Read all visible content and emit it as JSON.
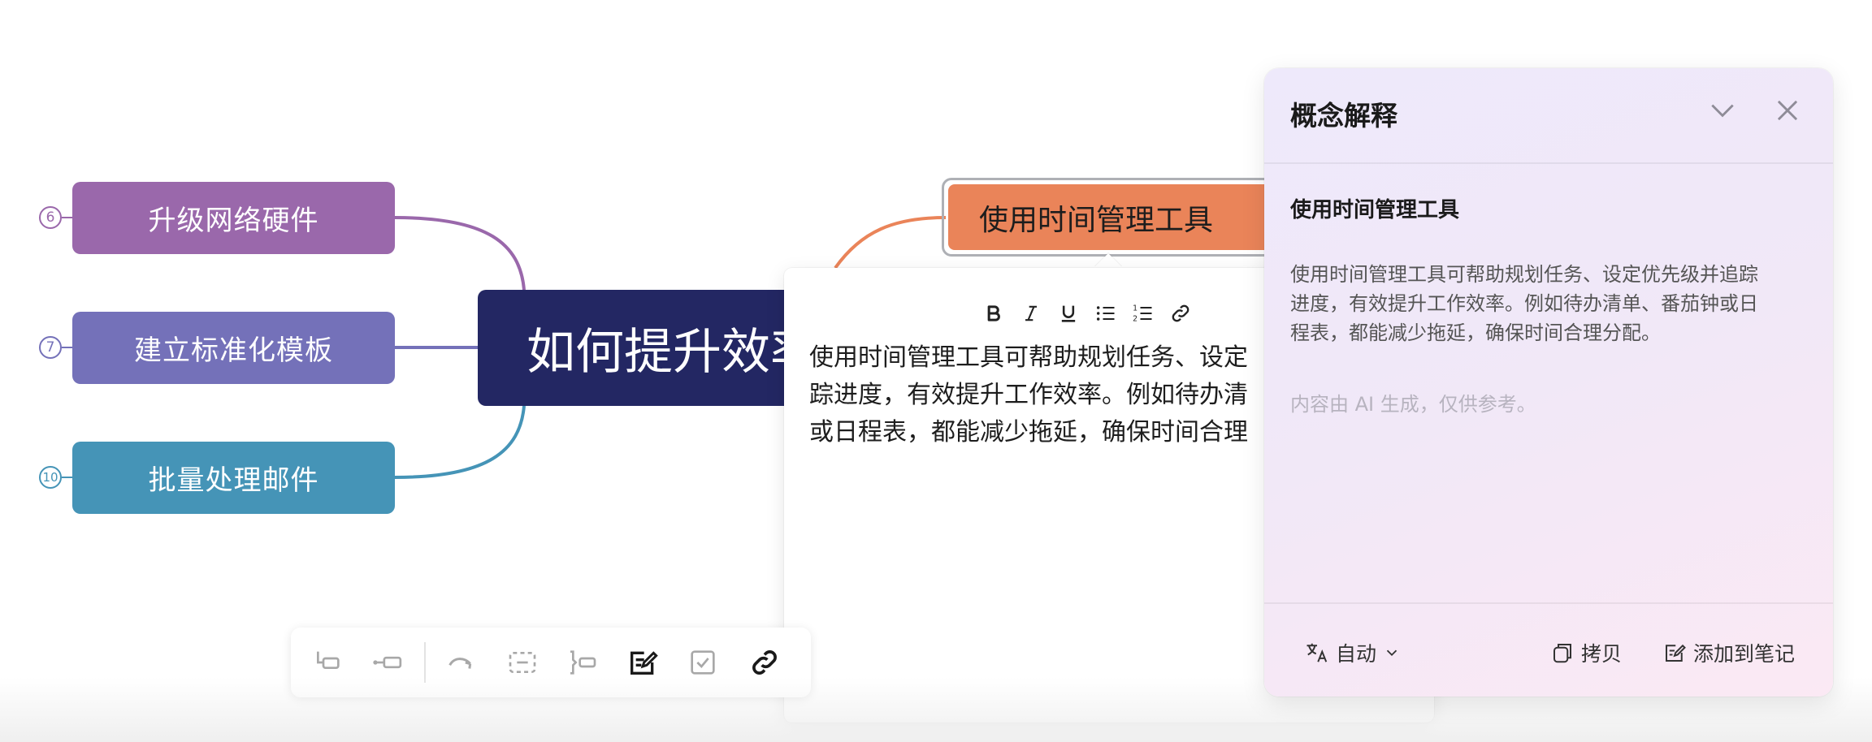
{
  "mindmap": {
    "root": {
      "title": "如何提升效率"
    },
    "left_branches": [
      {
        "label": "升级网络硬件",
        "badge": "6",
        "color": "#9a68ab"
      },
      {
        "label": "建立标准化模板",
        "badge": "7",
        "color": "#7471b9"
      },
      {
        "label": "批量处理邮件",
        "badge": "10",
        "color": "#4594b7"
      }
    ],
    "selected_topic": {
      "label": "使用时间管理工具",
      "color": "#ea8459"
    }
  },
  "note_editor": {
    "format_buttons": [
      {
        "name": "bold",
        "icon": "bold-icon"
      },
      {
        "name": "italic",
        "icon": "italic-icon"
      },
      {
        "name": "underline",
        "icon": "underline-icon"
      },
      {
        "name": "bullet-list",
        "icon": "bullet-list-icon"
      },
      {
        "name": "numbered-list",
        "icon": "numbered-list-icon"
      },
      {
        "name": "link",
        "icon": "link-icon"
      }
    ],
    "text_lines": [
      "使用时间管理工具可帮助规划任务、设定",
      "踪进度，有效提升工作效率。例如待办清",
      "或日程表，都能减少拖延，确保时间合理"
    ]
  },
  "bottom_toolbar": {
    "buttons": [
      {
        "name": "subtopic",
        "icon": "subtopic-icon"
      },
      {
        "name": "sibling-topic",
        "icon": "sibling-topic-icon"
      },
      {
        "name": "relationship",
        "icon": "relationship-icon"
      },
      {
        "name": "boundary",
        "icon": "boundary-icon"
      },
      {
        "name": "summary",
        "icon": "summary-icon"
      },
      {
        "name": "note",
        "icon": "note-icon",
        "active": true
      },
      {
        "name": "task",
        "icon": "checkbox-icon"
      },
      {
        "name": "link",
        "icon": "link-icon"
      }
    ]
  },
  "side_panel": {
    "title": "概念解释",
    "subtitle": "使用时间管理工具",
    "body_lines": [
      "使用时间管理工具可帮助规划任务、设定优先级并追踪",
      "进度，有效提升工作效率。例如待办清单、番茄钟或日",
      "程表，都能减少拖延，确保时间合理分配。"
    ],
    "disclaimer": "内容由 AI 生成，仅供参考。",
    "language_label": "自动",
    "copy_label": "拷贝",
    "add_to_note_label": "添加到笔记"
  }
}
